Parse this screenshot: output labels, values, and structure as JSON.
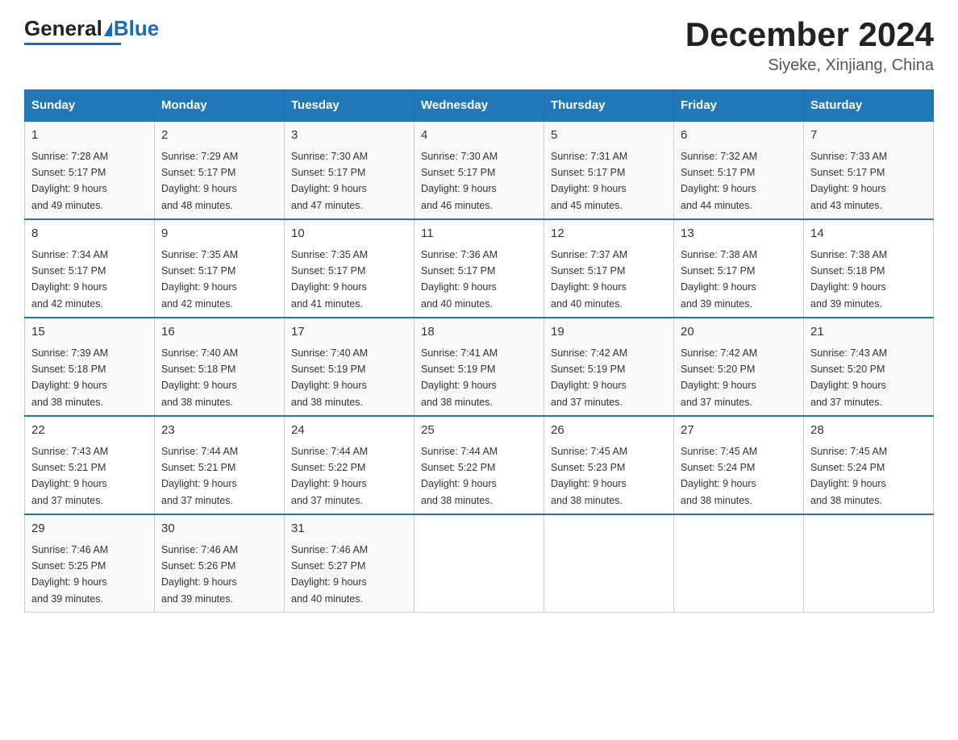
{
  "header": {
    "logo_general": "General",
    "logo_blue": "Blue",
    "main_title": "December 2024",
    "subtitle": "Siyeke, Xinjiang, China"
  },
  "days_of_week": [
    "Sunday",
    "Monday",
    "Tuesday",
    "Wednesday",
    "Thursday",
    "Friday",
    "Saturday"
  ],
  "weeks": [
    [
      {
        "day": "1",
        "sunrise": "7:28 AM",
        "sunset": "5:17 PM",
        "daylight": "9 hours and 49 minutes."
      },
      {
        "day": "2",
        "sunrise": "7:29 AM",
        "sunset": "5:17 PM",
        "daylight": "9 hours and 48 minutes."
      },
      {
        "day": "3",
        "sunrise": "7:30 AM",
        "sunset": "5:17 PM",
        "daylight": "9 hours and 47 minutes."
      },
      {
        "day": "4",
        "sunrise": "7:30 AM",
        "sunset": "5:17 PM",
        "daylight": "9 hours and 46 minutes."
      },
      {
        "day": "5",
        "sunrise": "7:31 AM",
        "sunset": "5:17 PM",
        "daylight": "9 hours and 45 minutes."
      },
      {
        "day": "6",
        "sunrise": "7:32 AM",
        "sunset": "5:17 PM",
        "daylight": "9 hours and 44 minutes."
      },
      {
        "day": "7",
        "sunrise": "7:33 AM",
        "sunset": "5:17 PM",
        "daylight": "9 hours and 43 minutes."
      }
    ],
    [
      {
        "day": "8",
        "sunrise": "7:34 AM",
        "sunset": "5:17 PM",
        "daylight": "9 hours and 42 minutes."
      },
      {
        "day": "9",
        "sunrise": "7:35 AM",
        "sunset": "5:17 PM",
        "daylight": "9 hours and 42 minutes."
      },
      {
        "day": "10",
        "sunrise": "7:35 AM",
        "sunset": "5:17 PM",
        "daylight": "9 hours and 41 minutes."
      },
      {
        "day": "11",
        "sunrise": "7:36 AM",
        "sunset": "5:17 PM",
        "daylight": "9 hours and 40 minutes."
      },
      {
        "day": "12",
        "sunrise": "7:37 AM",
        "sunset": "5:17 PM",
        "daylight": "9 hours and 40 minutes."
      },
      {
        "day": "13",
        "sunrise": "7:38 AM",
        "sunset": "5:17 PM",
        "daylight": "9 hours and 39 minutes."
      },
      {
        "day": "14",
        "sunrise": "7:38 AM",
        "sunset": "5:18 PM",
        "daylight": "9 hours and 39 minutes."
      }
    ],
    [
      {
        "day": "15",
        "sunrise": "7:39 AM",
        "sunset": "5:18 PM",
        "daylight": "9 hours and 38 minutes."
      },
      {
        "day": "16",
        "sunrise": "7:40 AM",
        "sunset": "5:18 PM",
        "daylight": "9 hours and 38 minutes."
      },
      {
        "day": "17",
        "sunrise": "7:40 AM",
        "sunset": "5:19 PM",
        "daylight": "9 hours and 38 minutes."
      },
      {
        "day": "18",
        "sunrise": "7:41 AM",
        "sunset": "5:19 PM",
        "daylight": "9 hours and 38 minutes."
      },
      {
        "day": "19",
        "sunrise": "7:42 AM",
        "sunset": "5:19 PM",
        "daylight": "9 hours and 37 minutes."
      },
      {
        "day": "20",
        "sunrise": "7:42 AM",
        "sunset": "5:20 PM",
        "daylight": "9 hours and 37 minutes."
      },
      {
        "day": "21",
        "sunrise": "7:43 AM",
        "sunset": "5:20 PM",
        "daylight": "9 hours and 37 minutes."
      }
    ],
    [
      {
        "day": "22",
        "sunrise": "7:43 AM",
        "sunset": "5:21 PM",
        "daylight": "9 hours and 37 minutes."
      },
      {
        "day": "23",
        "sunrise": "7:44 AM",
        "sunset": "5:21 PM",
        "daylight": "9 hours and 37 minutes."
      },
      {
        "day": "24",
        "sunrise": "7:44 AM",
        "sunset": "5:22 PM",
        "daylight": "9 hours and 37 minutes."
      },
      {
        "day": "25",
        "sunrise": "7:44 AM",
        "sunset": "5:22 PM",
        "daylight": "9 hours and 38 minutes."
      },
      {
        "day": "26",
        "sunrise": "7:45 AM",
        "sunset": "5:23 PM",
        "daylight": "9 hours and 38 minutes."
      },
      {
        "day": "27",
        "sunrise": "7:45 AM",
        "sunset": "5:24 PM",
        "daylight": "9 hours and 38 minutes."
      },
      {
        "day": "28",
        "sunrise": "7:45 AM",
        "sunset": "5:24 PM",
        "daylight": "9 hours and 38 minutes."
      }
    ],
    [
      {
        "day": "29",
        "sunrise": "7:46 AM",
        "sunset": "5:25 PM",
        "daylight": "9 hours and 39 minutes."
      },
      {
        "day": "30",
        "sunrise": "7:46 AM",
        "sunset": "5:26 PM",
        "daylight": "9 hours and 39 minutes."
      },
      {
        "day": "31",
        "sunrise": "7:46 AM",
        "sunset": "5:27 PM",
        "daylight": "9 hours and 40 minutes."
      },
      null,
      null,
      null,
      null
    ]
  ]
}
